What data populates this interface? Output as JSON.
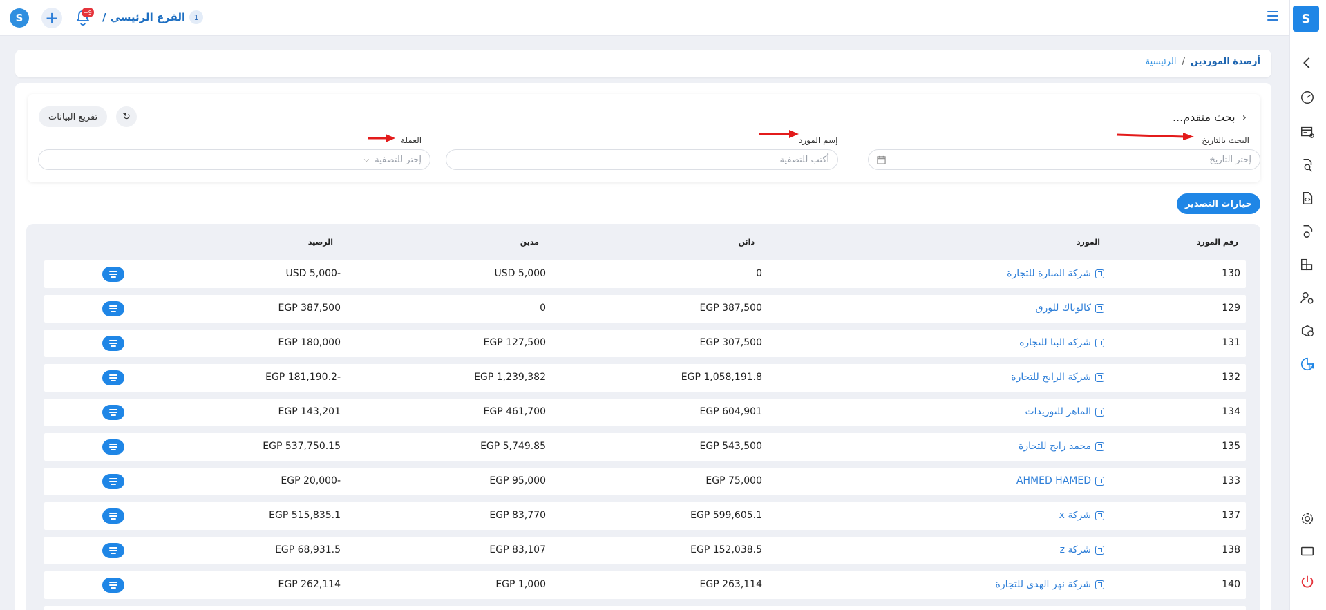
{
  "topbar": {
    "notifications_badge": "+9",
    "branch_number": "1",
    "branch_name": "الفرع الرئيسي",
    "branch_separator": "/"
  },
  "breadcrumb": {
    "home": "الرئيسية",
    "separator": "/",
    "current": "أرصدة الموردين"
  },
  "search": {
    "title": "بحث متقدم...",
    "reset_label": "تفريغ البيانات",
    "date_label": "البحث بالتاريخ",
    "date_placeholder": "إختر التاريخ",
    "supplier_label": "إسم المورد",
    "supplier_placeholder": "أكتب للتصفية",
    "currency_label": "العملة",
    "currency_placeholder": "إختر للتصفية"
  },
  "export_label": "خيارات التصدير",
  "table": {
    "headers": {
      "number": "رقم المورد",
      "supplier": "المورد",
      "credit": "دائن",
      "debit": "مدين",
      "balance": "الرصيد"
    },
    "rows": [
      {
        "number": "130",
        "supplier": "شركة المنارة للتجارة",
        "credit": "0",
        "debit": "USD 5,000",
        "balance": "USD 5,000-"
      },
      {
        "number": "129",
        "supplier": "كالوباك للورق",
        "credit": "EGP 387,500",
        "debit": "0",
        "balance": "EGP 387,500"
      },
      {
        "number": "131",
        "supplier": "شركة البنا للتجارة",
        "credit": "EGP 307,500",
        "debit": "EGP 127,500",
        "balance": "EGP 180,000"
      },
      {
        "number": "132",
        "supplier": "شركة الرابح للتجارة",
        "credit": "EGP 1,058,191.8",
        "debit": "EGP 1,239,382",
        "balance": "EGP 181,190.2-"
      },
      {
        "number": "134",
        "supplier": "الماهر للتوريدات",
        "credit": "EGP 604,901",
        "debit": "EGP 461,700",
        "balance": "EGP 143,201"
      },
      {
        "number": "135",
        "supplier": "محمد رابح للتجارة",
        "credit": "EGP 543,500",
        "debit": "EGP 5,749.85",
        "balance": "EGP 537,750.15"
      },
      {
        "number": "133",
        "supplier": "AHMED HAMED",
        "credit": "EGP 75,000",
        "debit": "EGP 95,000",
        "balance": "EGP 20,000-"
      },
      {
        "number": "137",
        "supplier": "شركة x",
        "credit": "EGP 599,605.1",
        "debit": "EGP 83,770",
        "balance": "EGP 515,835.1"
      },
      {
        "number": "138",
        "supplier": "شركة z",
        "credit": "EGP 152,038.5",
        "debit": "EGP 83,107",
        "balance": "EGP 68,931.5"
      },
      {
        "number": "140",
        "supplier": "شركة  نهر الهدى للتجارة",
        "credit": "EGP 263,114",
        "debit": "EGP 1,000",
        "balance": "EGP 262,114"
      }
    ]
  },
  "icons": {
    "sidebar": [
      "speedometer-icon",
      "cash-register-icon",
      "search-document-icon",
      "code-file-icon",
      "file-settings-icon",
      "boxes-icon",
      "users-settings-icon",
      "box-dollar-icon",
      "reports-chart-icon",
      "settings-gear-icon",
      "monitor-icon",
      "power-icon"
    ]
  },
  "colors": {
    "accent": "#1f86e6",
    "link": "#2f7fd8",
    "badge": "#e5343b",
    "power": "#e5343b"
  }
}
